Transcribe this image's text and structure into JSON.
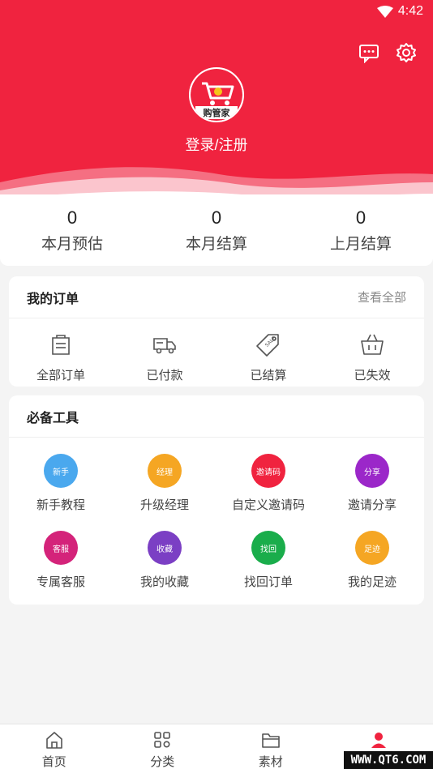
{
  "status_bar": {
    "time": "4:42"
  },
  "header": {
    "login_text": "登录/注册",
    "logo_text": "购管家"
  },
  "stats": [
    {
      "value": "0",
      "label": "本月预估"
    },
    {
      "value": "0",
      "label": "本月结算"
    },
    {
      "value": "0",
      "label": "上月结算"
    }
  ],
  "orders": {
    "title": "我的订单",
    "view_all": "查看全部",
    "items": [
      {
        "label": "全部订单",
        "icon": "order-list-icon"
      },
      {
        "label": "已付款",
        "icon": "truck-icon"
      },
      {
        "label": "已结算",
        "icon": "tag-icon"
      },
      {
        "label": "已失效",
        "icon": "basket-icon"
      }
    ]
  },
  "tools": {
    "title": "必备工具",
    "items": [
      {
        "label": "新手教程",
        "badge": "新手",
        "color": "#4aa8ee"
      },
      {
        "label": "升级经理",
        "badge": "经理",
        "color": "#f5a623"
      },
      {
        "label": "自定义邀请码",
        "badge": "邀请码",
        "color": "#f0233f"
      },
      {
        "label": "邀请分享",
        "badge": "分享",
        "color": "#9b27c9"
      },
      {
        "label": "专属客服",
        "badge": "客服",
        "color": "#d4237a"
      },
      {
        "label": "我的收藏",
        "badge": "收藏",
        "color": "#7b3fc4"
      },
      {
        "label": "找回订单",
        "badge": "找回",
        "color": "#1aad4b"
      },
      {
        "label": "我的足迹",
        "badge": "足迹",
        "color": "#f5a623"
      }
    ]
  },
  "tabbar": [
    {
      "label": "首页",
      "icon": "home-icon"
    },
    {
      "label": "分类",
      "icon": "grid-icon"
    },
    {
      "label": "素材",
      "icon": "folder-icon"
    },
    {
      "label": "",
      "icon": "profile-icon",
      "active": true
    }
  ],
  "watermark": "WWW.QT6.COM",
  "colors": {
    "brand": "#f0233f"
  }
}
